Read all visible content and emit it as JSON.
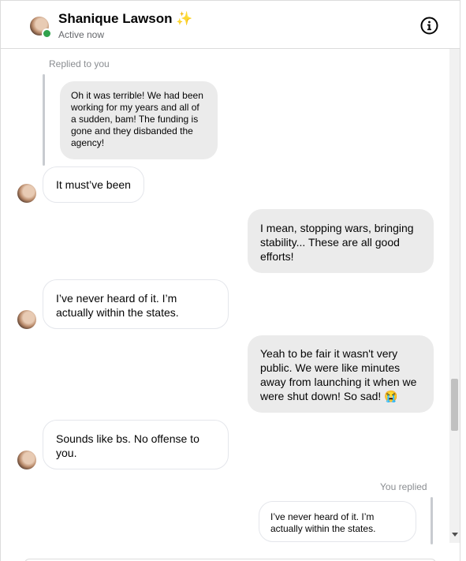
{
  "header": {
    "contact_name": "Shanique Lawson",
    "contact_emoji": "✨",
    "status": "Active now",
    "info_icon": "info-icon",
    "presence_color": "#31a24c"
  },
  "thread": {
    "reply_top": {
      "label": "Replied to you",
      "quoted_text": "Oh it was terrible! We had been working for my years and all of a sudden, bam! The funding is gone and they disbanded the agency!"
    },
    "messages": [
      {
        "direction": "incoming",
        "text": "It must’ve been"
      },
      {
        "direction": "outgoing",
        "text": "I mean, stopping wars, bringing stability... These are all good efforts!"
      },
      {
        "direction": "incoming",
        "text": "I’ve never heard of it. I’m actually within the states."
      },
      {
        "direction": "outgoing",
        "text": "Yeah to be fair it wasn't very public. We were like minutes away from launching it when we were shut down! So sad! 😭"
      },
      {
        "direction": "incoming",
        "text": "Sounds like bs. No offense to you."
      }
    ],
    "reply_bottom": {
      "label": "You replied",
      "quoted_text": "I’ve never heard of it. I’m actually within the states."
    }
  },
  "colors": {
    "incoming_bubble_border": "#e4e6eb",
    "outgoing_bubble": "#ebebeb",
    "meta_text": "#8a8d91"
  }
}
